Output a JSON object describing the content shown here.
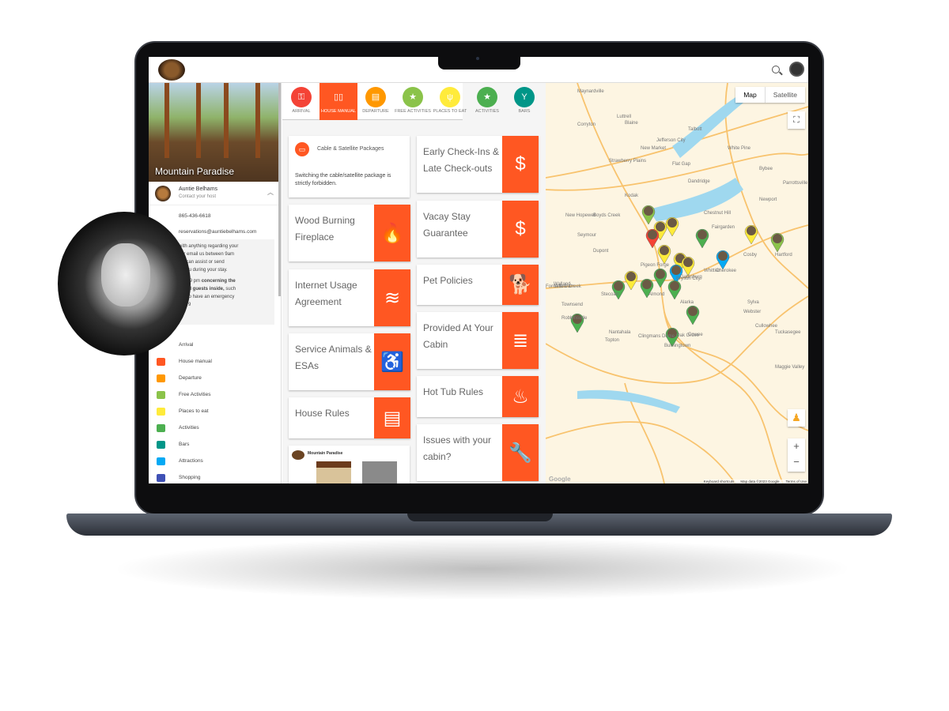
{
  "topbar": {
    "search_icon": "search-icon",
    "account_icon": "account-circle-icon"
  },
  "sidebar": {
    "property_title": "Mountain Paradise",
    "host_name": "Auntie Belhams",
    "host_subtitle": "Contact your host",
    "phone": "865-436-6618",
    "email": "reservations@auntiebelhams.com",
    "message_lines": [
      "with anything regarding your",
      "l or email us between 9am",
      "we can assist or send",
      "lp you during your stay."
    ],
    "message2_a": "after 9 pm ",
    "message2_b": "concerning the",
    "message2_c": "n and guests inside,",
    "message2_d": " such",
    "message2_e": "we do have an emergency",
    "message2_f": "-8879",
    "nav": [
      {
        "label": "Arrival",
        "color": "#f44336"
      },
      {
        "label": "House manual",
        "color": "#ff5722"
      },
      {
        "label": "Departure",
        "color": "#ff9800"
      },
      {
        "label": "Free Activities",
        "color": "#8bc34a"
      },
      {
        "label": "Places to eat",
        "color": "#ffeb3b"
      },
      {
        "label": "Activities",
        "color": "#4caf50"
      },
      {
        "label": "Bars",
        "color": "#009688"
      },
      {
        "label": "Attractions",
        "color": "#03a9f4"
      },
      {
        "label": "Shopping",
        "color": "#3f51b5"
      }
    ]
  },
  "tabs": [
    {
      "label": "ARRIVAL",
      "color": "#f44336",
      "icon": "key-icon",
      "glyph": "⚿"
    },
    {
      "label": "HOUSE MANUAL",
      "color": "#ff5722",
      "icon": "book-icon",
      "glyph": "▯▯",
      "active": true
    },
    {
      "label": "DEPARTURE",
      "color": "#ff9800",
      "icon": "clipboard-icon",
      "glyph": "▤"
    },
    {
      "label": "FREE ACTIVITIES",
      "color": "#8bc34a",
      "icon": "ticket-icon",
      "glyph": "★"
    },
    {
      "label": "PLACES TO EAT",
      "color": "#ffeb3b",
      "icon": "utensils-icon",
      "glyph": "ψ"
    },
    {
      "label": "ACTIVITIES",
      "color": "#4caf50",
      "icon": "ticket-icon",
      "glyph": "★"
    },
    {
      "label": "BARS",
      "color": "#009688",
      "icon": "cocktail-icon",
      "glyph": "Y"
    }
  ],
  "cards": {
    "cable": {
      "title": "Cable & Satellite Packages",
      "body": "Switching the cable/satellite package is strictly forbidden."
    },
    "left": [
      {
        "title": "Wood Burning Fireplace",
        "icon": "fireplace-icon",
        "glyph": "🔥"
      },
      {
        "title": "Internet Usage Agreement",
        "icon": "wifi-icon",
        "glyph": "≋"
      },
      {
        "title": "Service Animals & ESAs",
        "icon": "accessible-icon",
        "glyph": "♿"
      },
      {
        "title": "House Rules",
        "icon": "clipboard-icon",
        "glyph": "▤"
      }
    ],
    "floorplan": {
      "title": "Mountain Paradise"
    },
    "right": [
      {
        "title": "Early Check-Ins & Late Check-outs",
        "icon": "dollar-icon",
        "glyph": "$"
      },
      {
        "title": "Vacay Stay Guarantee",
        "icon": "dollar-icon",
        "glyph": "$"
      },
      {
        "title": "Pet Policies",
        "icon": "dog-icon",
        "glyph": "🐕"
      },
      {
        "title": "Provided At Your Cabin",
        "icon": "towels-icon",
        "glyph": "≣"
      },
      {
        "title": "Hot Tub Rules",
        "icon": "hot-tub-icon",
        "glyph": "♨"
      },
      {
        "title": "Issues with your cabin?",
        "icon": "wrench-icon",
        "glyph": "🔧"
      }
    ]
  },
  "map": {
    "type_map": "Map",
    "type_satellite": "Satellite",
    "zoom_in": "+",
    "zoom_out": "−",
    "labels": [
      "Maynardville",
      "Luttrell",
      "Corryton",
      "Blaine",
      "Talbott",
      "Jefferson City",
      "New Market",
      "White Pine",
      "Strawberry Plains",
      "Flat Gap",
      "Bybee",
      "Dandridge",
      "Parrottsville",
      "Kodak",
      "Newport",
      "Boyds Creek",
      "Chestnut Hill",
      "New Hopewell",
      "Fairgarden",
      "Seymour",
      "Dupont",
      "Cosby",
      "Hartford",
      "Pigeon Forge",
      "Gatlinburg",
      "Walland",
      "Townsend",
      "Clingmans Dome",
      "Maggie Valley",
      "Cherokee",
      "Bryson City",
      "Whittier",
      "Fontana Dam",
      "Yellow Creek",
      "Stecoah",
      "Almond",
      "Alarka",
      "Sylva",
      "Webster",
      "Robbinsville",
      "Cullowhee",
      "Nantahala",
      "Oak Grove",
      "Cowee",
      "Topton",
      "Burningtown",
      "Tuckasegee"
    ],
    "footer": [
      "Keyboard shortcuts",
      "Map data ©2023 Google",
      "Terms of Use"
    ],
    "logo": "Google"
  }
}
